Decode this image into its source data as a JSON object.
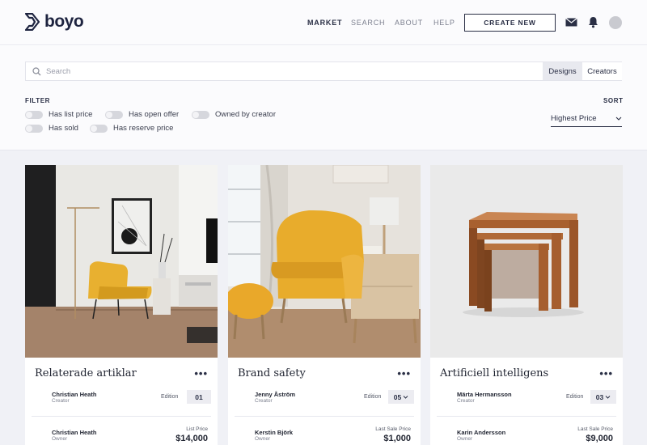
{
  "brand": {
    "name": "boyo"
  },
  "nav": {
    "market": "MARKET",
    "search": "SEARCH",
    "about": "ABOUT",
    "help": "HELP",
    "create": "CREATE NEW"
  },
  "icons": {
    "mail": "mail-icon",
    "bell": "bell-icon",
    "search": "search-icon",
    "chevron": "chevron-down-icon"
  },
  "search": {
    "placeholder": "Search",
    "tab_designs": "Designs",
    "tab_creators": "Creators",
    "active_tab": "Designs"
  },
  "filter": {
    "label": "FILTER",
    "toggles": [
      "Has list price",
      "Has open offer",
      "Owned by creator",
      "Has sold",
      "Has reserve price"
    ]
  },
  "sort": {
    "label": "SORT",
    "selected": "Highest Price"
  },
  "cards": [
    {
      "title": "Relaterade artiklar",
      "creator": "Christian Heath",
      "creator_role": "Creator",
      "edition_label": "Edition",
      "edition": "01",
      "owner": "Christian Heath",
      "owner_role": "Owner",
      "price_label": "List Price",
      "price": "$14,000"
    },
    {
      "title": "Brand safety",
      "creator": "Jenny Åström",
      "creator_role": "Creator",
      "edition_label": "Edition",
      "edition": "05",
      "owner": "Kerstin Björk",
      "owner_role": "Owner",
      "price_label": "Last Sale Price",
      "price": "$1,000"
    },
    {
      "title": "Artificiell intelligens",
      "creator": "Märta Hermansson",
      "creator_role": "Creator",
      "edition_label": "Edition",
      "edition": "03",
      "owner": "Karin Andersson",
      "owner_role": "Owner",
      "price_label": "Last Sale Price",
      "price": "$9,000"
    }
  ],
  "colors": {
    "brand": "#1e2440",
    "page_bg": "#f0f1f6",
    "chair": "#e8b030"
  }
}
